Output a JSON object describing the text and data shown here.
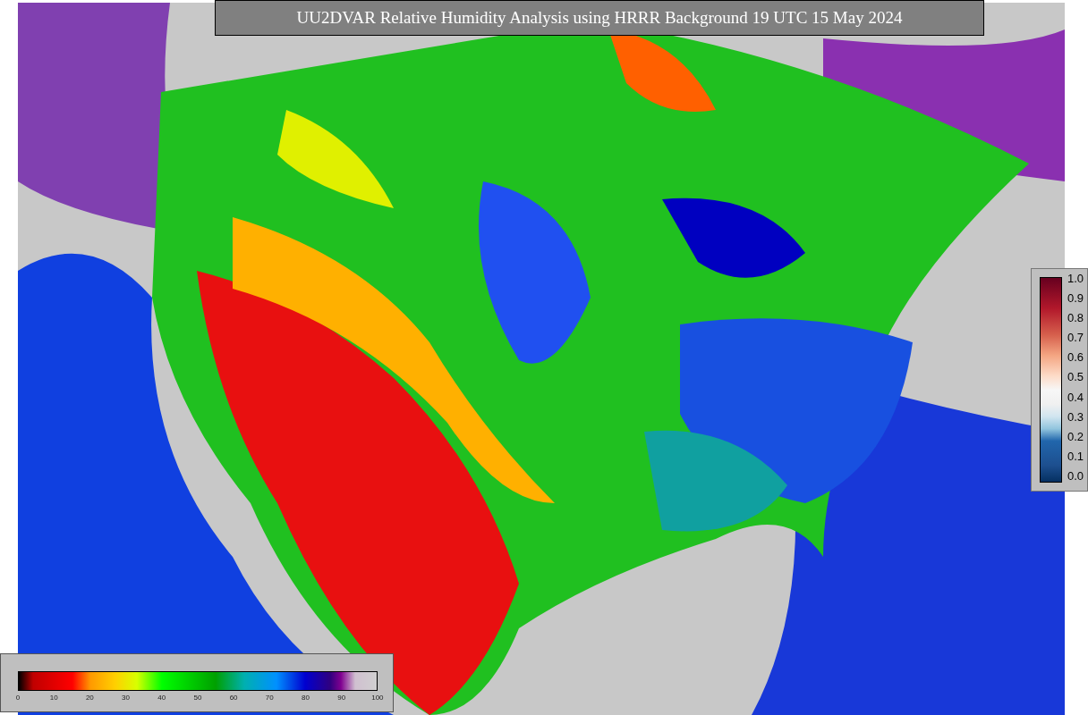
{
  "title": "UU2DVAR Relative Humidity Analysis using HRRR Background 19 UTC 15 May 2024",
  "vertical_colorbar": {
    "ticks": [
      "1.0",
      "0.9",
      "0.8",
      "0.7",
      "0.6",
      "0.5",
      "0.4",
      "0.3",
      "0.2",
      "0.1",
      "0.0"
    ]
  },
  "horizontal_colorbar": {
    "ticks": [
      "0",
      "10",
      "20",
      "30",
      "40",
      "50",
      "60",
      "70",
      "80",
      "90",
      "100"
    ]
  }
}
